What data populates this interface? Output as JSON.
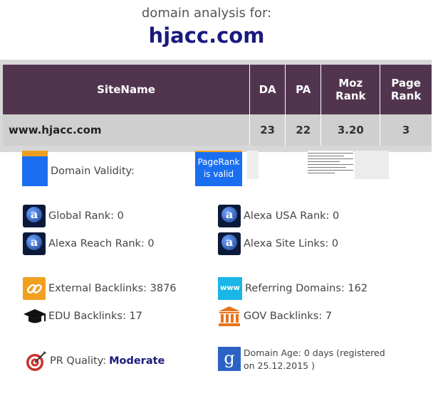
{
  "header": {
    "caption": "domain analysis for:",
    "domain": "hjacc.com"
  },
  "table": {
    "columns": [
      "SiteName",
      "DA",
      "PA",
      "Moz Rank",
      "Page Rank"
    ],
    "row": {
      "site": "www.hjacc.com",
      "da": "23",
      "pa": "22",
      "moz_rank": "3.20",
      "page_rank": "3"
    }
  },
  "validity": {
    "label": "Domain Validity:",
    "pagerank_badge": "PageRank is valid"
  },
  "stats": {
    "global_rank": "Global Rank: 0",
    "alexa_usa_rank": "Alexa USA Rank: 0",
    "alexa_reach_rank": "Alexa Reach Rank: 0",
    "alexa_site_links": "Alexa Site Links: 0",
    "external_backlinks": "External Backlinks: 3876",
    "referring_domains": "Referring Domains: 162",
    "edu_backlinks": "EDU Backlinks: 17",
    "gov_backlinks": "GOV Backlinks: 7",
    "pr_quality_label": "PR Quality:",
    "pr_quality_value": "Moderate",
    "domain_age": "Domain Age: 0 days (registered on 25.12.2015 )"
  },
  "icons": {
    "www_text": "www",
    "google_glyph": "g",
    "alexa_glyph": "a"
  },
  "colors": {
    "header_bg": "#51354f",
    "domain_title": "#1a1a7e",
    "accent_blue": "#1a6ef0",
    "accent_orange": "#f0a020"
  }
}
